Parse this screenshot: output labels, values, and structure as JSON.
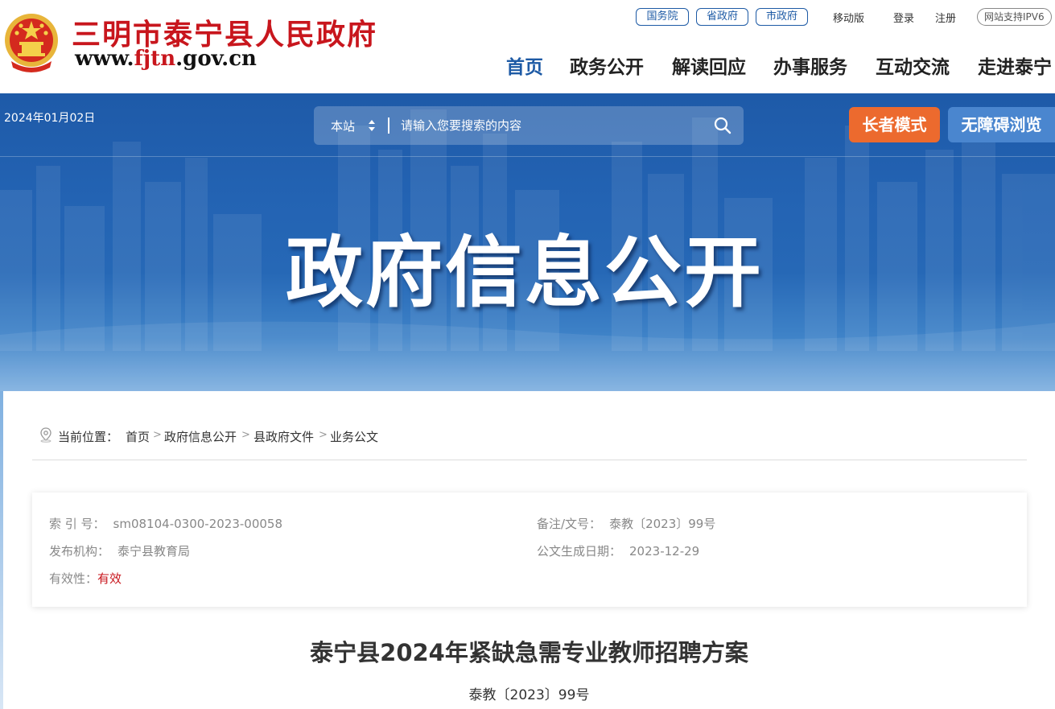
{
  "header": {
    "site_title": "三明市泰宁县人民政府",
    "url_prefix": "www.",
    "url_highlight": "fjtn",
    "url_suffix": ".gov.cn",
    "top_links": [
      "国务院",
      "省政府",
      "市政府"
    ],
    "mobile": "移动版",
    "login": "登录",
    "register": "注册",
    "ipv6": "网站支持IPV6",
    "nav": [
      "首页",
      "政务公开",
      "解读回应",
      "办事服务",
      "互动交流",
      "走进泰宁"
    ],
    "active_nav": "首页"
  },
  "banner": {
    "date": "2024年01月02日",
    "search_scope": "本站",
    "search_placeholder": "请输入您要搜索的内容",
    "elder_mode": "长者模式",
    "accessibility": "无障碍浏览",
    "title": "政府信息公开"
  },
  "breadcrumb": {
    "label": "当前位置：",
    "items": [
      "首页",
      "政府信息公开",
      "县政府文件",
      "业务公文"
    ],
    "separator": ">"
  },
  "meta": {
    "index_label": "索 引 号：",
    "index_value": "sm08104-0300-2023-00058",
    "doc_no_label": "备注/文号：",
    "doc_no_value": "泰教〔2023〕99号",
    "publisher_label": "发布机构：",
    "publisher_value": "泰宁县教育局",
    "date_label": "公文生成日期：",
    "date_value": "2023-12-29",
    "validity_label": "有效性：",
    "validity_value": "有效"
  },
  "document": {
    "title": "泰宁县2024年紧缺急需专业教师招聘方案",
    "number": "泰教〔2023〕99号"
  },
  "colors": {
    "brand_red": "#c8161d",
    "nav_blue": "#1d5aa5",
    "elder_orange": "#ec6a2e",
    "access_blue": "#4a86cf",
    "banner_blue": "#2363b3"
  }
}
